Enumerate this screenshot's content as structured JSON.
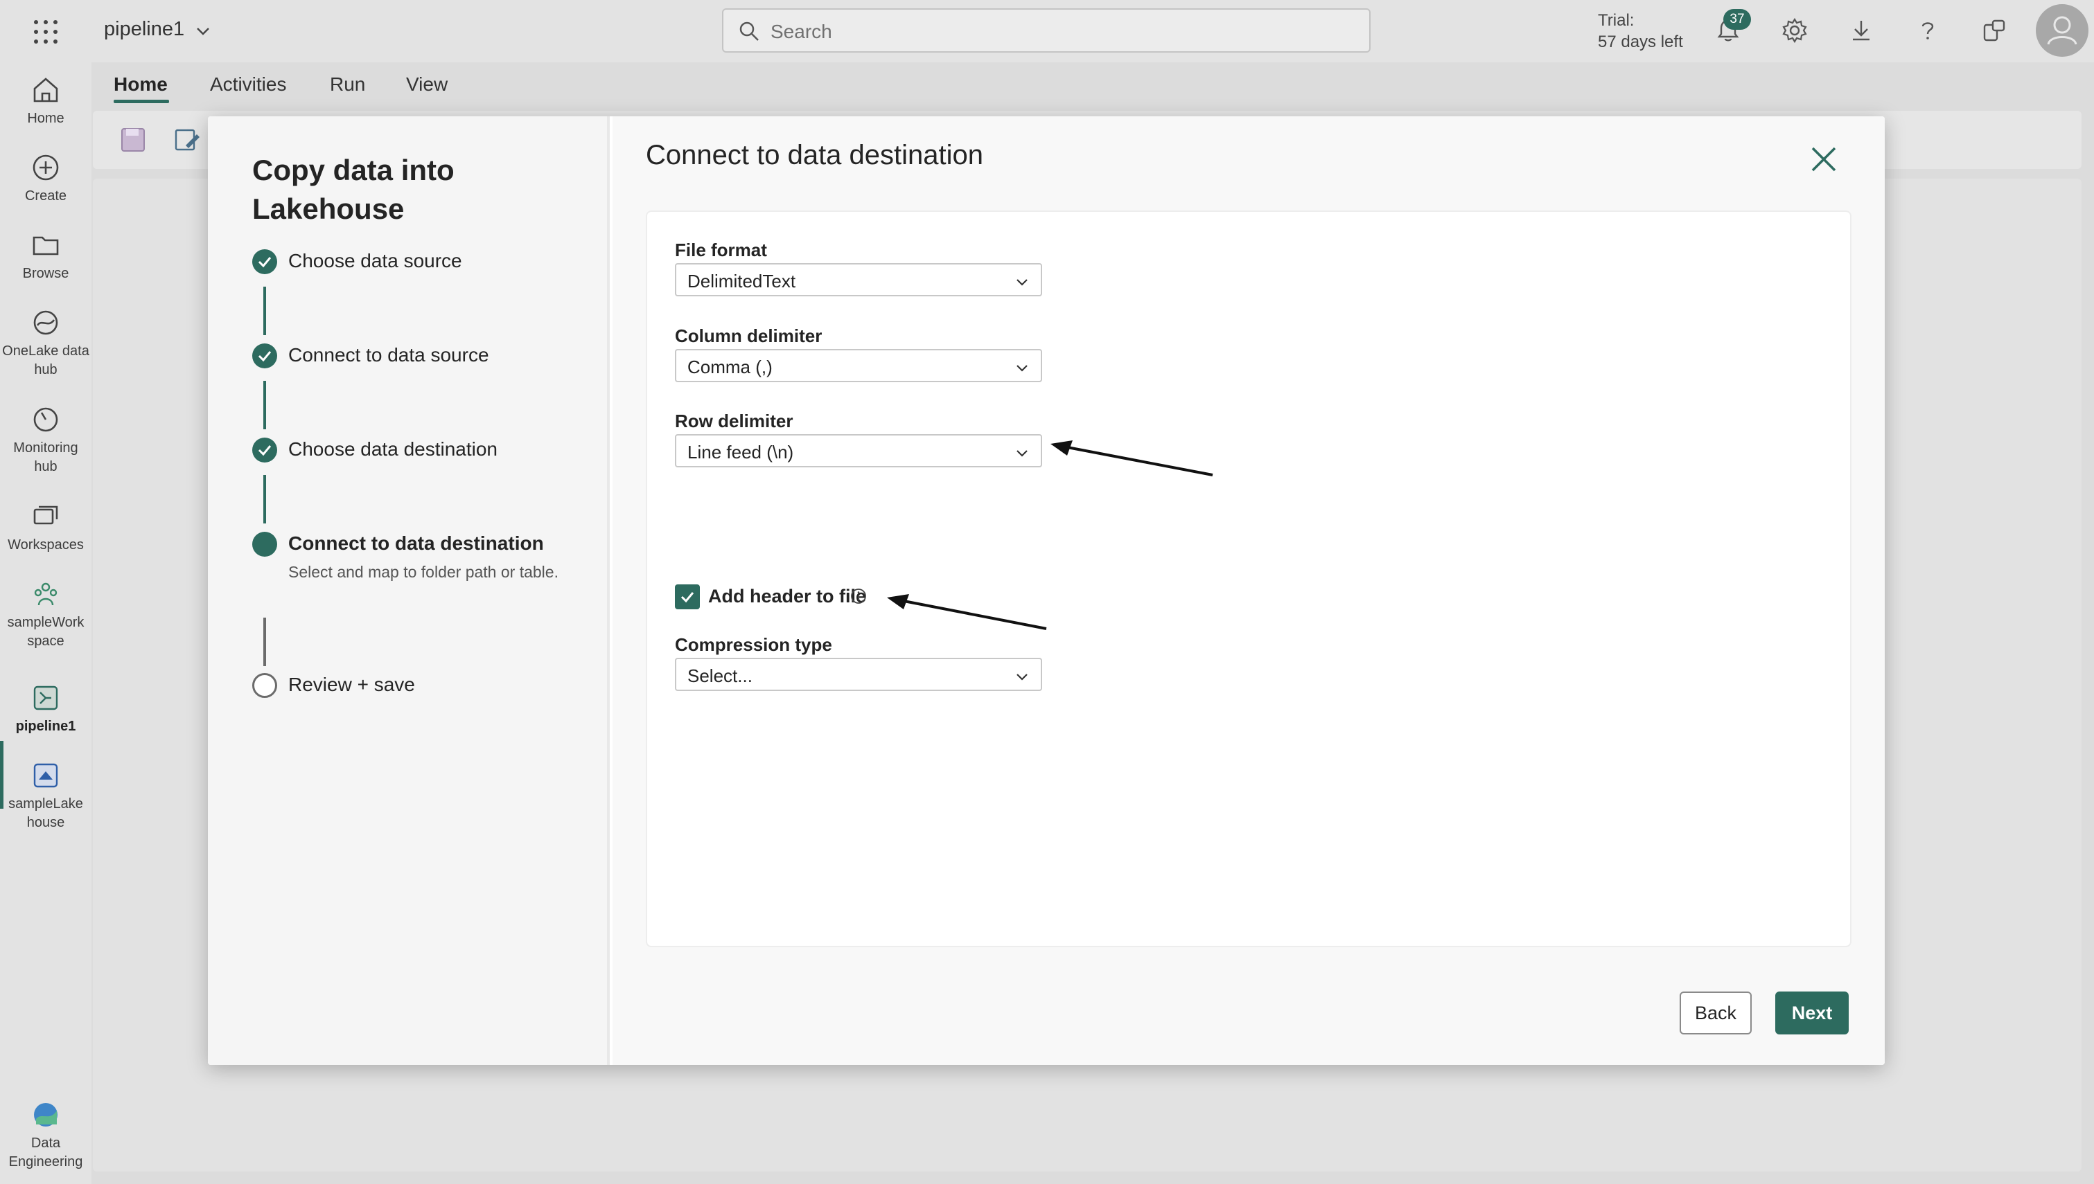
{
  "header": {
    "app_name": "pipeline1",
    "search_placeholder": "Search",
    "trial_line1": "Trial:",
    "trial_line2": "57 days left",
    "notification_count": "37"
  },
  "rail": {
    "items": [
      {
        "label": "Home"
      },
      {
        "label": "Create"
      },
      {
        "label": "Browse"
      },
      {
        "label": "OneLake data hub"
      },
      {
        "label": "Monitoring hub"
      },
      {
        "label": "Workspaces"
      },
      {
        "label": "sampleWork space"
      },
      {
        "label": "pipeline1"
      },
      {
        "label": "sampleLake house"
      },
      {
        "label": "Data Engineering"
      }
    ]
  },
  "ribbon": {
    "tabs": [
      "Home",
      "Activities",
      "Run",
      "View"
    ]
  },
  "wizard": {
    "title": "Copy data into Lakehouse",
    "steps": [
      {
        "label": "Choose data source",
        "state": "done"
      },
      {
        "label": "Connect to data source",
        "state": "done"
      },
      {
        "label": "Choose data destination",
        "state": "done"
      },
      {
        "label": "Connect to data destination",
        "state": "current",
        "description": "Select and map to folder path or table."
      },
      {
        "label": "Review + save",
        "state": "todo"
      }
    ]
  },
  "panel": {
    "title": "Connect to data destination",
    "fields": {
      "file_format": {
        "label": "File format",
        "value": "DelimitedText"
      },
      "column_delimiter": {
        "label": "Column delimiter",
        "value": "Comma (,)"
      },
      "row_delimiter": {
        "label": "Row delimiter",
        "value": "Line feed (\\n)"
      },
      "compression_type": {
        "label": "Compression type",
        "value": "Select..."
      }
    },
    "header_checkbox": {
      "label": "Add header to file",
      "checked": true
    },
    "back_label": "Back",
    "next_label": "Next"
  },
  "colors": {
    "accent": "#2d6b5f"
  }
}
